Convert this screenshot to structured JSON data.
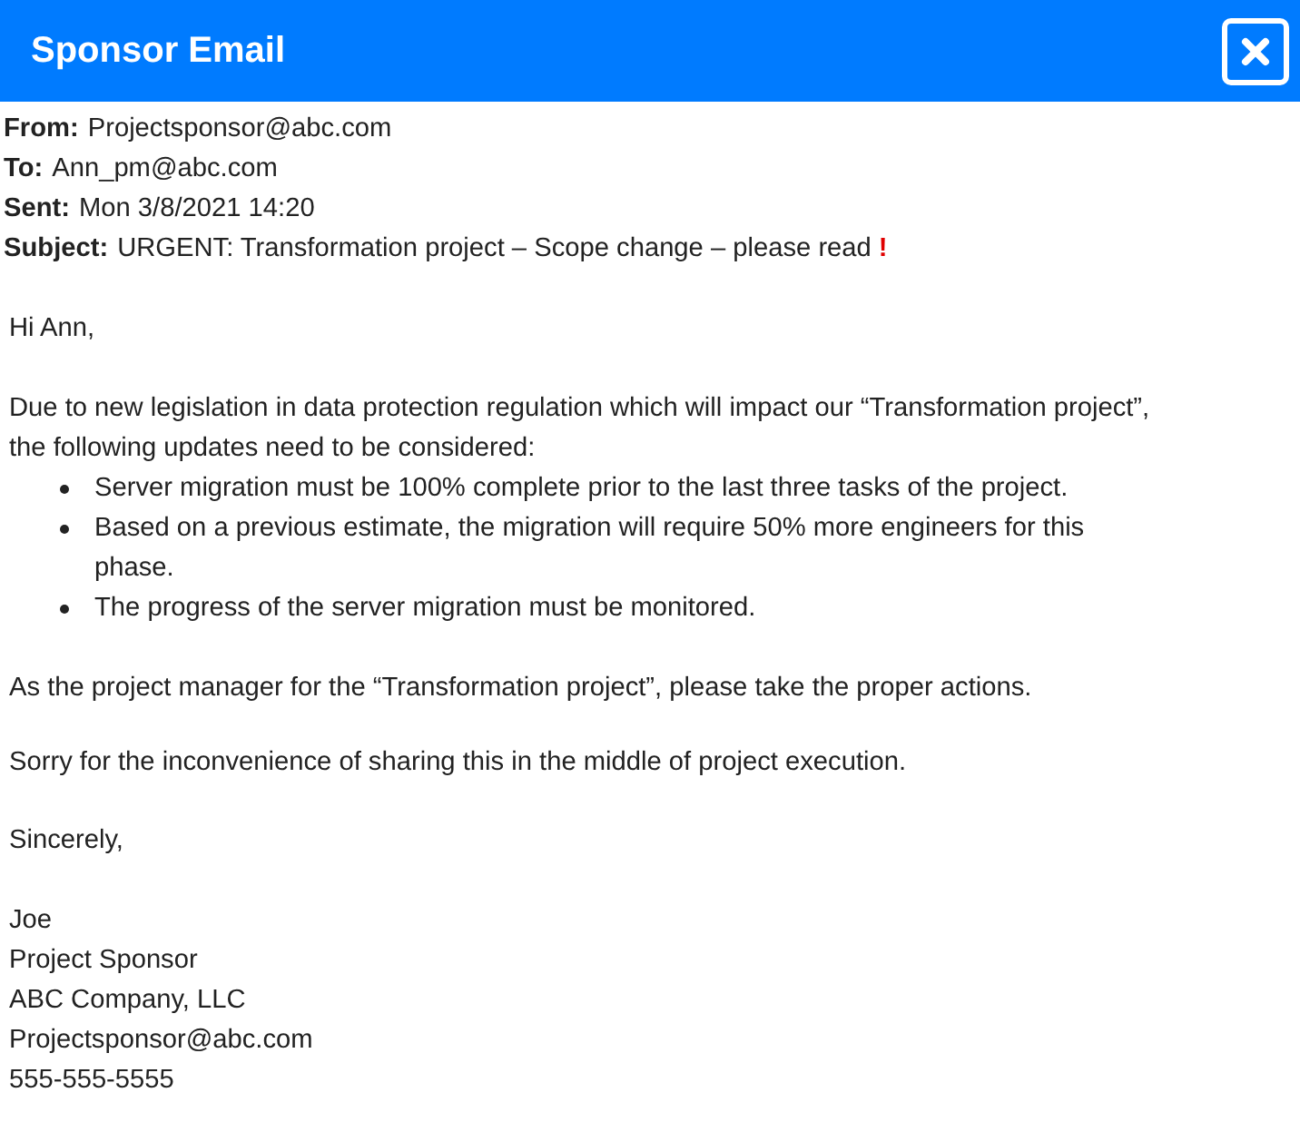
{
  "window": {
    "title": "Sponsor Email"
  },
  "headers": [
    {
      "label": "From:",
      "value": "Projectsponsor@abc.com"
    },
    {
      "label": "To:",
      "value": "Ann_pm@abc.com"
    },
    {
      "label": "Sent:",
      "value": "Mon 3/8/2021 14:20"
    },
    {
      "label": "Subject:",
      "value": "URGENT: Transformation project – Scope change – please read",
      "mark": "!"
    }
  ],
  "greeting": "Hi Ann,",
  "intro": "Due to new legislation in data protection regulation which will impact our “Transformation project”, the following updates need to be considered:",
  "bullets": [
    "Server migration must be 100% complete prior to the last three tasks of the project.",
    "Based on a previous estimate, the migration will require 50% more engineers for this phase.",
    "The progress of the server migration must be monitored."
  ],
  "paragraphs": [
    "As the project manager for the “Transformation project”, please take the proper actions.",
    "Sorry for the inconvenience of sharing this in the middle of project execution.",
    "Sincerely,"
  ],
  "signature": [
    "Joe",
    "Project Sponsor",
    "ABC Company, LLC",
    "Projectsponsor@abc.com",
    "555-555-5555"
  ]
}
